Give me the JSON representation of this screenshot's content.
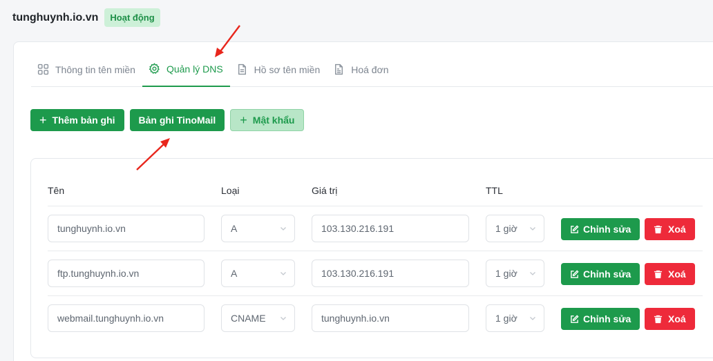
{
  "header": {
    "domain": "tunghuynh.io.vn",
    "status": "Hoạt động"
  },
  "tabs": [
    {
      "label": "Thông tin tên miền",
      "icon": "grid-icon",
      "active": false
    },
    {
      "label": "Quản lý DNS",
      "icon": "gear-icon",
      "active": true
    },
    {
      "label": "Hồ sơ tên miền",
      "icon": "document-icon",
      "active": false
    },
    {
      "label": "Hoá đơn",
      "icon": "invoice-icon",
      "active": false
    }
  ],
  "actions": {
    "add_record": "Thêm bản ghi",
    "tinomail_record": "Bản ghi TinoMail",
    "password": "Mật khẩu"
  },
  "table": {
    "headers": {
      "name": "Tên",
      "type": "Loại",
      "value": "Giá trị",
      "ttl": "TTL"
    },
    "rows": [
      {
        "name": "tunghuynh.io.vn",
        "type": "A",
        "value": "103.130.216.191",
        "ttl": "1 giờ"
      },
      {
        "name": "ftp.tunghuynh.io.vn",
        "type": "A",
        "value": "103.130.216.191",
        "ttl": "1 giờ"
      },
      {
        "name": "webmail.tunghuynh.io.vn",
        "type": "CNAME",
        "value": "tunghuynh.io.vn",
        "ttl": "1 giờ"
      }
    ],
    "edit_label": "Chỉnh sửa",
    "delete_label": "Xoá"
  },
  "colors": {
    "accent": "#1d9a4c",
    "danger": "#ee2a3a",
    "annotation": "#e8261c"
  }
}
